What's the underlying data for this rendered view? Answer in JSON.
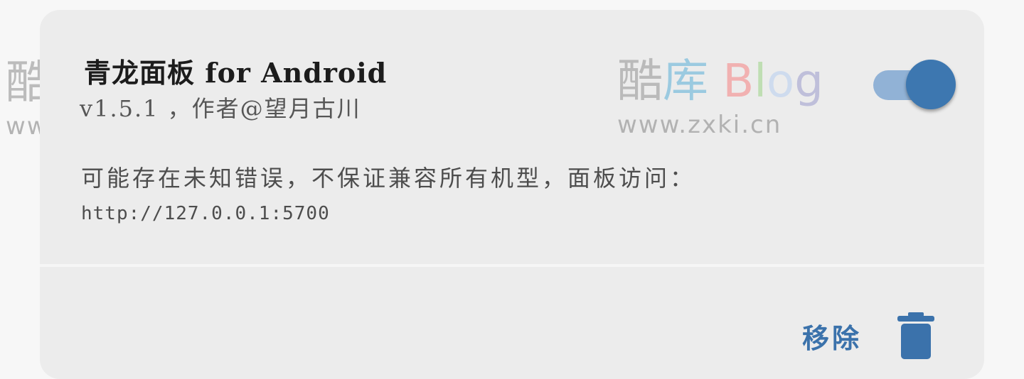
{
  "plugin": {
    "title": "青龙面板 for Android",
    "meta": "v1.5.1 ，作者@望月古川",
    "description_line1": "可能存在未知错误，不保证兼容所有机型，面板访问：",
    "description_line2": "http://127.0.0.1:5700",
    "enabled": true
  },
  "actions": {
    "remove_label": "移除",
    "remove_icon": "trash-icon"
  },
  "watermark": {
    "logo_cn_1": "酷",
    "logo_cn_2": "库",
    "logo_b": "B",
    "logo_l": "l",
    "logo_o": "o",
    "logo_g": "g",
    "url": "www.zxki.cn"
  },
  "colors": {
    "accent": "#3d77b0",
    "toggle_track": "#91b2d6",
    "card_bg": "#ececec",
    "page_bg": "#f7f7f7"
  }
}
